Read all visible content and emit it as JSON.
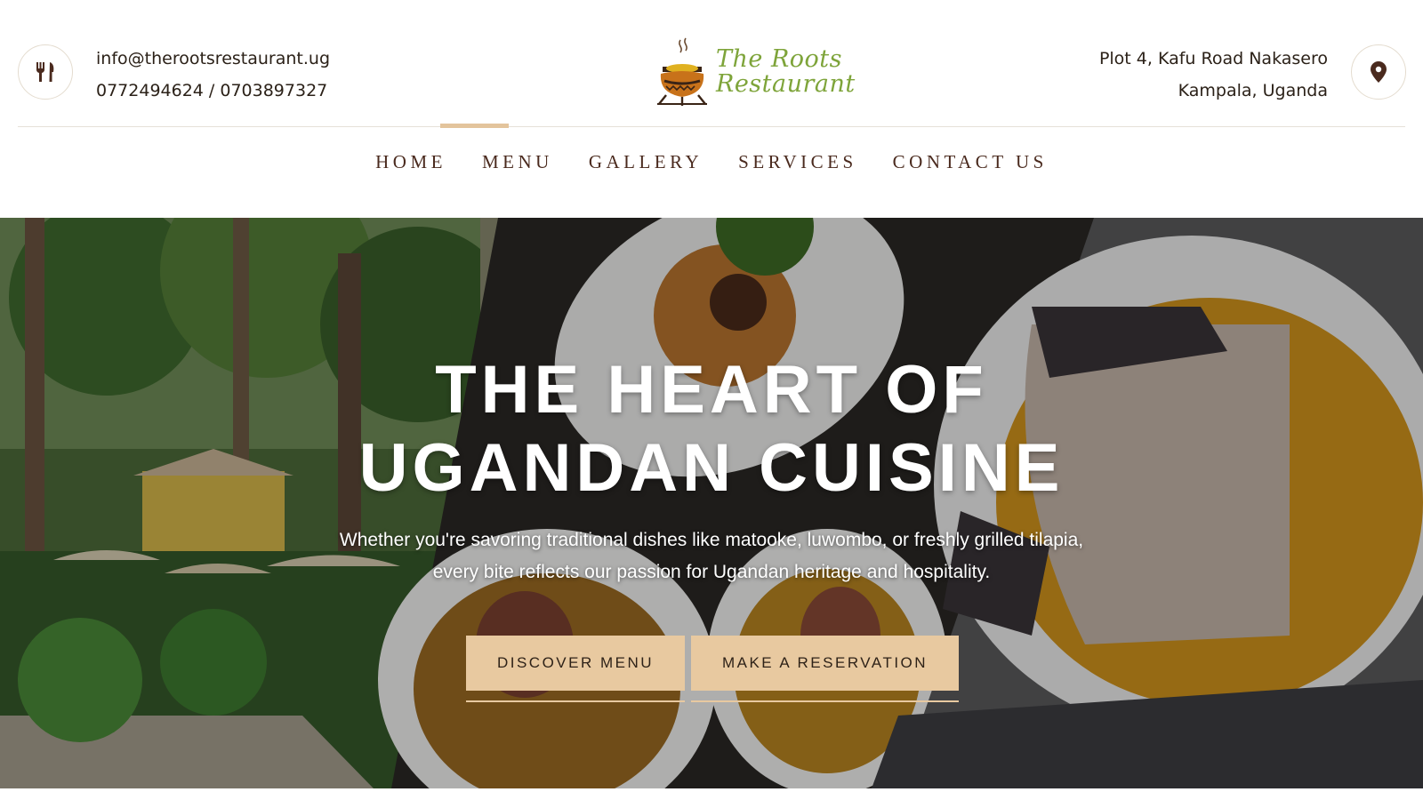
{
  "header": {
    "email": "info@therootsrestaurant.ug",
    "phones": "0772494624 / 0703897327",
    "address_line1": "Plot 4, Kafu Road Nakasero",
    "address_line2": "Kampala, Uganda",
    "left_icon": "utensils-icon",
    "right_icon": "map-pin-icon"
  },
  "logo": {
    "line1": "The Roots",
    "line2": "Restaurant",
    "text_color": "#7ea43a",
    "pot_color": "#c8721a"
  },
  "nav": {
    "items": [
      {
        "label": "HOME",
        "active": true
      },
      {
        "label": "MENU",
        "active": false
      },
      {
        "label": "GALLERY",
        "active": false
      },
      {
        "label": "SERVICES",
        "active": false
      },
      {
        "label": "CONTACT US",
        "active": false
      }
    ],
    "active_color": "#e3c49c",
    "text_color": "#4a2a1e"
  },
  "hero": {
    "title_line1": "THE HEART OF",
    "title_line2": "UGANDAN CUISINE",
    "subtitle_line1": "Whether you're savoring traditional dishes like matooke, luwombo, or freshly grilled tilapia,",
    "subtitle_line2": "every bite reflects our passion for Ugandan heritage and hospitality.",
    "primary_button": "DISCOVER MENU",
    "secondary_button": "MAKE A RESERVATION",
    "button_color": "#e8c9a0"
  }
}
